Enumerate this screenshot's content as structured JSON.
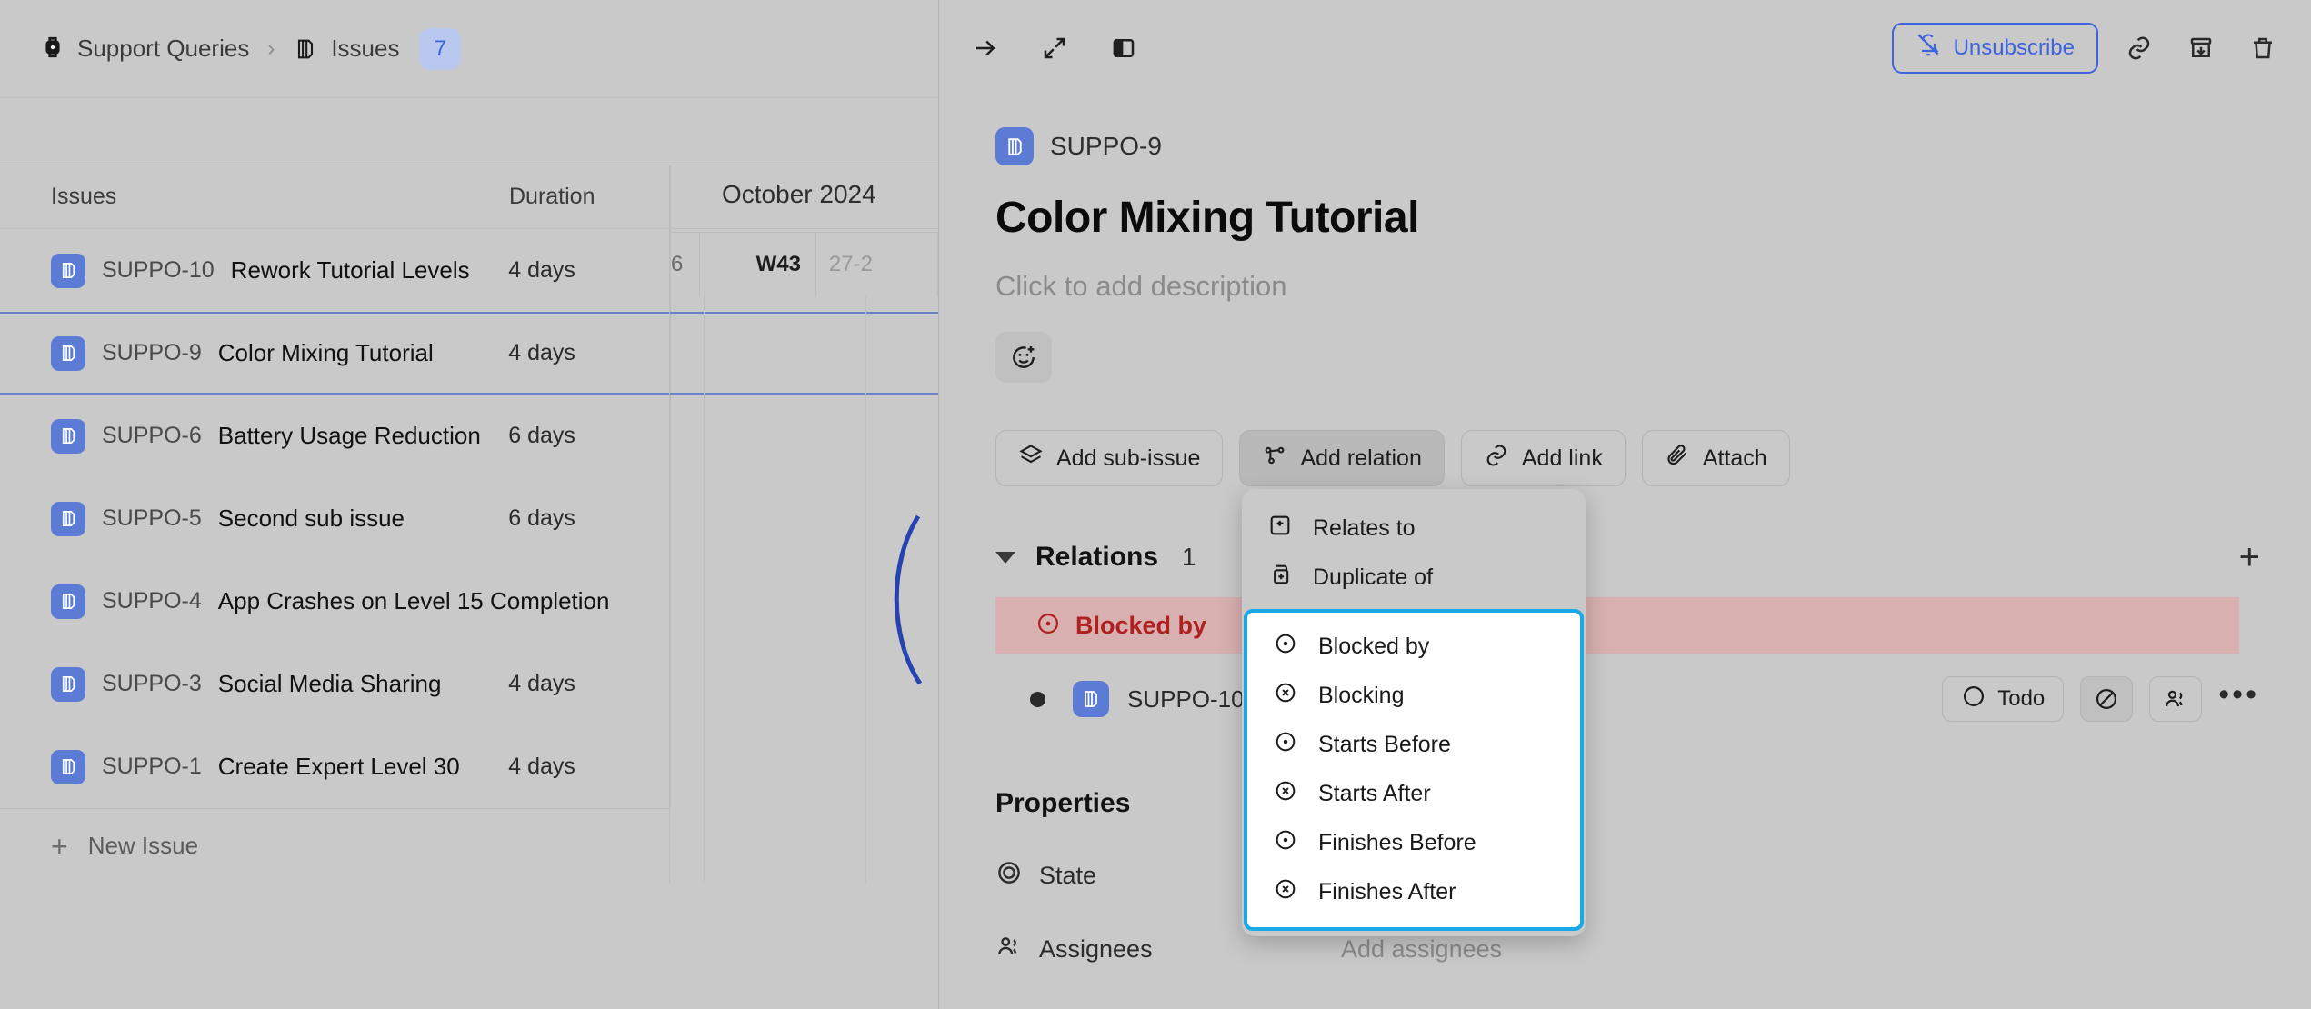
{
  "breadcrumb": {
    "project_icon": "watch-icon",
    "project": "Support Queries",
    "separator": "›",
    "section_icon": "stack-icon",
    "section": "Issues",
    "count": "7"
  },
  "table": {
    "headers": {
      "issues": "Issues",
      "duration": "Duration"
    },
    "rows": [
      {
        "key": "SUPPO-10",
        "title": "Rework Tutorial Levels",
        "duration": "4 days",
        "selected": false
      },
      {
        "key": "SUPPO-9",
        "title": "Color Mixing Tutorial",
        "duration": "4 days",
        "selected": true
      },
      {
        "key": "SUPPO-6",
        "title": "Battery Usage Reduction",
        "duration": "6 days",
        "selected": false
      },
      {
        "key": "SUPPO-5",
        "title": "Second sub issue",
        "duration": "6 days",
        "selected": false
      },
      {
        "key": "SUPPO-4",
        "title": "App Crashes on Level 15 Completion",
        "duration": "",
        "selected": false
      },
      {
        "key": "SUPPO-3",
        "title": "Social Media Sharing",
        "duration": "4 days",
        "selected": false
      },
      {
        "key": "SUPPO-1",
        "title": "Create Expert Level 30",
        "duration": "4 days",
        "selected": false
      }
    ],
    "new_issue": "New Issue"
  },
  "timeline": {
    "month": "October 2024",
    "weeks": [
      {
        "label": "6",
        "kind": "prev"
      },
      {
        "label": "W43",
        "kind": "current"
      },
      {
        "label": "27-2",
        "kind": "next"
      }
    ]
  },
  "panel": {
    "header": {
      "close_icon": "arrow-right-icon",
      "expand_icon": "expand-diagonal-icon",
      "sidebar_icon": "panel-toggle-icon",
      "unsubscribe_label": "Unsubscribe",
      "unsubscribe_icon": "bell-off-icon",
      "link_icon": "link-icon",
      "archive_icon": "archive-icon",
      "delete_icon": "trash-icon",
      "accent": "#3d63dd"
    },
    "issue": {
      "key": "SUPPO-9",
      "title": "Color Mixing Tutorial",
      "description_placeholder": "Click to add description",
      "reaction_icon": "emoji-plus-icon"
    },
    "actions": [
      {
        "label": "Add sub-issue",
        "icon": "layers-icon",
        "active": false
      },
      {
        "label": "Add relation",
        "icon": "relation-icon",
        "active": true
      },
      {
        "label": "Add link",
        "icon": "link-icon",
        "active": false
      },
      {
        "label": "Attach",
        "icon": "paperclip-icon",
        "active": false
      }
    ],
    "relations": {
      "title": "Relations",
      "count": "1",
      "add_icon": "plus-icon",
      "group_label": "Blocked by",
      "group_icon": "circle-dot-icon",
      "group_color": "#b02020",
      "group_bg": "#d9b0b0",
      "items": [
        {
          "key": "SUPPO-10",
          "state_label": "Todo",
          "state_icon": "circle-icon",
          "blocked_icon": "no-entry-icon",
          "assignee_icon": "users-icon",
          "more_icon": "ellipsis-icon"
        }
      ]
    },
    "properties": {
      "title": "Properties",
      "rows": [
        {
          "label": "State",
          "icon": "target-icon",
          "value": ""
        },
        {
          "label": "Assignees",
          "icon": "users-icon",
          "value": "Add assignees"
        }
      ]
    }
  },
  "dropdown": {
    "top_items": [
      {
        "label": "Relates to",
        "icon": "relates-to-icon"
      },
      {
        "label": "Duplicate of",
        "icon": "duplicate-icon"
      }
    ],
    "highlighted_items": [
      {
        "label": "Blocked by",
        "icon": "circle-dot-icon"
      },
      {
        "label": "Blocking",
        "icon": "circle-x-icon"
      },
      {
        "label": "Starts Before",
        "icon": "circle-dot-icon"
      },
      {
        "label": "Starts After",
        "icon": "circle-x-icon"
      },
      {
        "label": "Finishes Before",
        "icon": "circle-dot-icon"
      },
      {
        "label": "Finishes After",
        "icon": "circle-x-icon"
      }
    ],
    "highlight_color": "#17a9e8"
  }
}
